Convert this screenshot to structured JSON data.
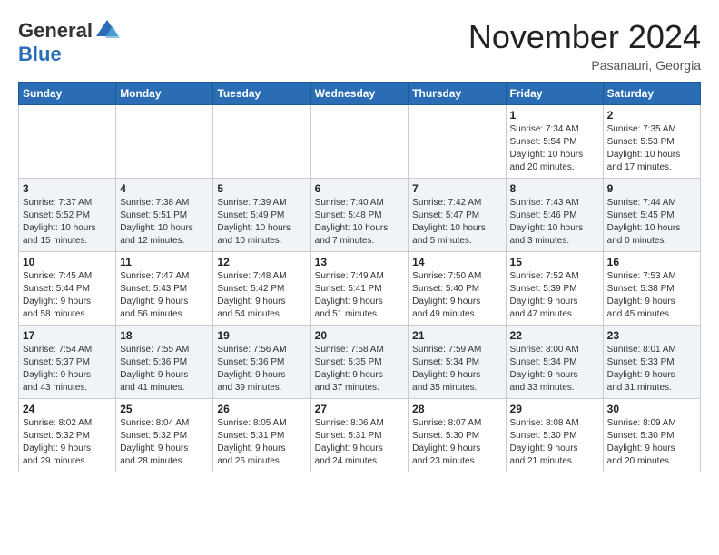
{
  "header": {
    "logo_general": "General",
    "logo_blue": "Blue",
    "month_title": "November 2024",
    "location": "Pasanauri, Georgia"
  },
  "days_of_week": [
    "Sunday",
    "Monday",
    "Tuesday",
    "Wednesday",
    "Thursday",
    "Friday",
    "Saturday"
  ],
  "weeks": [
    [
      {
        "day": "",
        "info": ""
      },
      {
        "day": "",
        "info": ""
      },
      {
        "day": "",
        "info": ""
      },
      {
        "day": "",
        "info": ""
      },
      {
        "day": "",
        "info": ""
      },
      {
        "day": "1",
        "info": "Sunrise: 7:34 AM\nSunset: 5:54 PM\nDaylight: 10 hours\nand 20 minutes."
      },
      {
        "day": "2",
        "info": "Sunrise: 7:35 AM\nSunset: 5:53 PM\nDaylight: 10 hours\nand 17 minutes."
      }
    ],
    [
      {
        "day": "3",
        "info": "Sunrise: 7:37 AM\nSunset: 5:52 PM\nDaylight: 10 hours\nand 15 minutes."
      },
      {
        "day": "4",
        "info": "Sunrise: 7:38 AM\nSunset: 5:51 PM\nDaylight: 10 hours\nand 12 minutes."
      },
      {
        "day": "5",
        "info": "Sunrise: 7:39 AM\nSunset: 5:49 PM\nDaylight: 10 hours\nand 10 minutes."
      },
      {
        "day": "6",
        "info": "Sunrise: 7:40 AM\nSunset: 5:48 PM\nDaylight: 10 hours\nand 7 minutes."
      },
      {
        "day": "7",
        "info": "Sunrise: 7:42 AM\nSunset: 5:47 PM\nDaylight: 10 hours\nand 5 minutes."
      },
      {
        "day": "8",
        "info": "Sunrise: 7:43 AM\nSunset: 5:46 PM\nDaylight: 10 hours\nand 3 minutes."
      },
      {
        "day": "9",
        "info": "Sunrise: 7:44 AM\nSunset: 5:45 PM\nDaylight: 10 hours\nand 0 minutes."
      }
    ],
    [
      {
        "day": "10",
        "info": "Sunrise: 7:45 AM\nSunset: 5:44 PM\nDaylight: 9 hours\nand 58 minutes."
      },
      {
        "day": "11",
        "info": "Sunrise: 7:47 AM\nSunset: 5:43 PM\nDaylight: 9 hours\nand 56 minutes."
      },
      {
        "day": "12",
        "info": "Sunrise: 7:48 AM\nSunset: 5:42 PM\nDaylight: 9 hours\nand 54 minutes."
      },
      {
        "day": "13",
        "info": "Sunrise: 7:49 AM\nSunset: 5:41 PM\nDaylight: 9 hours\nand 51 minutes."
      },
      {
        "day": "14",
        "info": "Sunrise: 7:50 AM\nSunset: 5:40 PM\nDaylight: 9 hours\nand 49 minutes."
      },
      {
        "day": "15",
        "info": "Sunrise: 7:52 AM\nSunset: 5:39 PM\nDaylight: 9 hours\nand 47 minutes."
      },
      {
        "day": "16",
        "info": "Sunrise: 7:53 AM\nSunset: 5:38 PM\nDaylight: 9 hours\nand 45 minutes."
      }
    ],
    [
      {
        "day": "17",
        "info": "Sunrise: 7:54 AM\nSunset: 5:37 PM\nDaylight: 9 hours\nand 43 minutes."
      },
      {
        "day": "18",
        "info": "Sunrise: 7:55 AM\nSunset: 5:36 PM\nDaylight: 9 hours\nand 41 minutes."
      },
      {
        "day": "19",
        "info": "Sunrise: 7:56 AM\nSunset: 5:36 PM\nDaylight: 9 hours\nand 39 minutes."
      },
      {
        "day": "20",
        "info": "Sunrise: 7:58 AM\nSunset: 5:35 PM\nDaylight: 9 hours\nand 37 minutes."
      },
      {
        "day": "21",
        "info": "Sunrise: 7:59 AM\nSunset: 5:34 PM\nDaylight: 9 hours\nand 35 minutes."
      },
      {
        "day": "22",
        "info": "Sunrise: 8:00 AM\nSunset: 5:34 PM\nDaylight: 9 hours\nand 33 minutes."
      },
      {
        "day": "23",
        "info": "Sunrise: 8:01 AM\nSunset: 5:33 PM\nDaylight: 9 hours\nand 31 minutes."
      }
    ],
    [
      {
        "day": "24",
        "info": "Sunrise: 8:02 AM\nSunset: 5:32 PM\nDaylight: 9 hours\nand 29 minutes."
      },
      {
        "day": "25",
        "info": "Sunrise: 8:04 AM\nSunset: 5:32 PM\nDaylight: 9 hours\nand 28 minutes."
      },
      {
        "day": "26",
        "info": "Sunrise: 8:05 AM\nSunset: 5:31 PM\nDaylight: 9 hours\nand 26 minutes."
      },
      {
        "day": "27",
        "info": "Sunrise: 8:06 AM\nSunset: 5:31 PM\nDaylight: 9 hours\nand 24 minutes."
      },
      {
        "day": "28",
        "info": "Sunrise: 8:07 AM\nSunset: 5:30 PM\nDaylight: 9 hours\nand 23 minutes."
      },
      {
        "day": "29",
        "info": "Sunrise: 8:08 AM\nSunset: 5:30 PM\nDaylight: 9 hours\nand 21 minutes."
      },
      {
        "day": "30",
        "info": "Sunrise: 8:09 AM\nSunset: 5:30 PM\nDaylight: 9 hours\nand 20 minutes."
      }
    ]
  ]
}
